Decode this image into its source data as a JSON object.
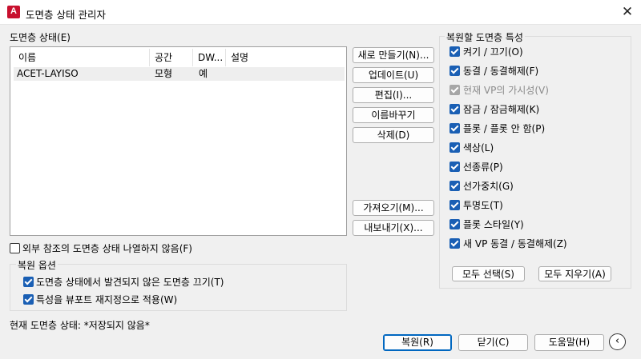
{
  "window": {
    "title": "도면층 상태 관리자",
    "app_icon_letter": "A"
  },
  "states": {
    "label": "도면층 상태(E)",
    "columns": [
      "이름",
      "공간",
      "DW...",
      "설명"
    ],
    "rows": [
      {
        "name": "ACET-LAYISO",
        "space": "모형",
        "dw": "예",
        "desc": ""
      }
    ]
  },
  "buttons": {
    "new": "새로 만들기(N)...",
    "update": "업데이트(U)",
    "edit": "편집(I)...",
    "rename": "이름바꾸기",
    "delete": "삭제(D)",
    "import": "가져오기(M)...",
    "export": "내보내기(X)...",
    "restore": "복원(R)",
    "close": "닫기(C)",
    "help": "도움말(H)",
    "select_all": "모두 선택(S)",
    "clear_all": "모두 지우기(A)"
  },
  "xref_checkbox": {
    "label": "외부 참조의 도면층 상태 나열하지 않음(F)",
    "checked": false
  },
  "restore_options": {
    "legend": "복원 옵션",
    "items": [
      {
        "label": "도면층 상태에서 발견되지 않은 도면층 끄기(T)",
        "checked": true
      },
      {
        "label": "특성을 뷰포트 재지정으로 적용(W)",
        "checked": true
      }
    ]
  },
  "current_state": "현재 도면층 상태: *저장되지 않음*",
  "properties": {
    "legend": "복원할 도면층 특성",
    "items": [
      {
        "label": "켜기 / 끄기(O)",
        "checked": true,
        "disabled": false
      },
      {
        "label": "동결 / 동결해제(F)",
        "checked": true,
        "disabled": false
      },
      {
        "label": "현재 VP의 가시성(V)",
        "checked": true,
        "disabled": true
      },
      {
        "label": "잠금 / 잠금해제(K)",
        "checked": true,
        "disabled": false
      },
      {
        "label": "플롯 / 플롯 안 함(P)",
        "checked": true,
        "disabled": false
      },
      {
        "label": "색상(L)",
        "checked": true,
        "disabled": false
      },
      {
        "label": "선종류(P)",
        "checked": true,
        "disabled": false
      },
      {
        "label": "선가중치(G)",
        "checked": true,
        "disabled": false
      },
      {
        "label": "투명도(T)",
        "checked": true,
        "disabled": false
      },
      {
        "label": "플롯 스타일(Y)",
        "checked": true,
        "disabled": false
      },
      {
        "label": "새 VP 동결 / 동결해제(Z)",
        "checked": true,
        "disabled": false
      }
    ]
  },
  "icons": {
    "close": "close-icon",
    "collapse": "chevron-left-icon",
    "app": "autocad-app-icon"
  }
}
